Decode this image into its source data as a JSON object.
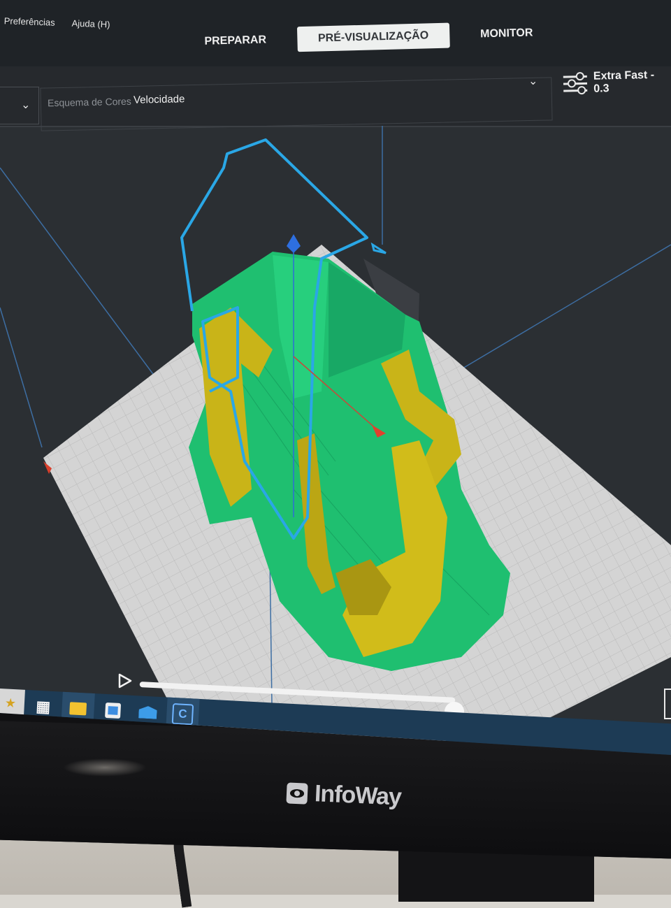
{
  "app": {
    "menu": [
      "Preferências",
      "Ajuda (H)"
    ],
    "tabs": [
      {
        "label": "PREPARAR",
        "active": false
      },
      {
        "label": "PRÉ-VISUALIZAÇÃO",
        "active": true
      },
      {
        "label": "MONITOR",
        "active": false
      }
    ],
    "color_scheme": {
      "label": "Esquema de Cores",
      "value": "Velocidade"
    },
    "print_profile": "Extra Fast - 0.3",
    "icons": {
      "left_dropdown": "chevron-down-icon",
      "main_dropdown": "chevron-down-icon",
      "profile": "settings-sliders-icon",
      "play": "play-icon"
    },
    "colors": {
      "ui_dark": "#1f2327",
      "build_plate": "#d4d4d4",
      "model_walls": "#1fbf70",
      "model_support": "#c9b418",
      "travel_moves": "#2aa7e6",
      "active_tab": "#eef0ef"
    }
  },
  "taskbar": {
    "apps": [
      "start-icon",
      "task-view-icon",
      "file-explorer-icon",
      "store-icon",
      "mail-icon",
      "cura-icon"
    ]
  },
  "monitor": {
    "brand": "InfoWay"
  }
}
